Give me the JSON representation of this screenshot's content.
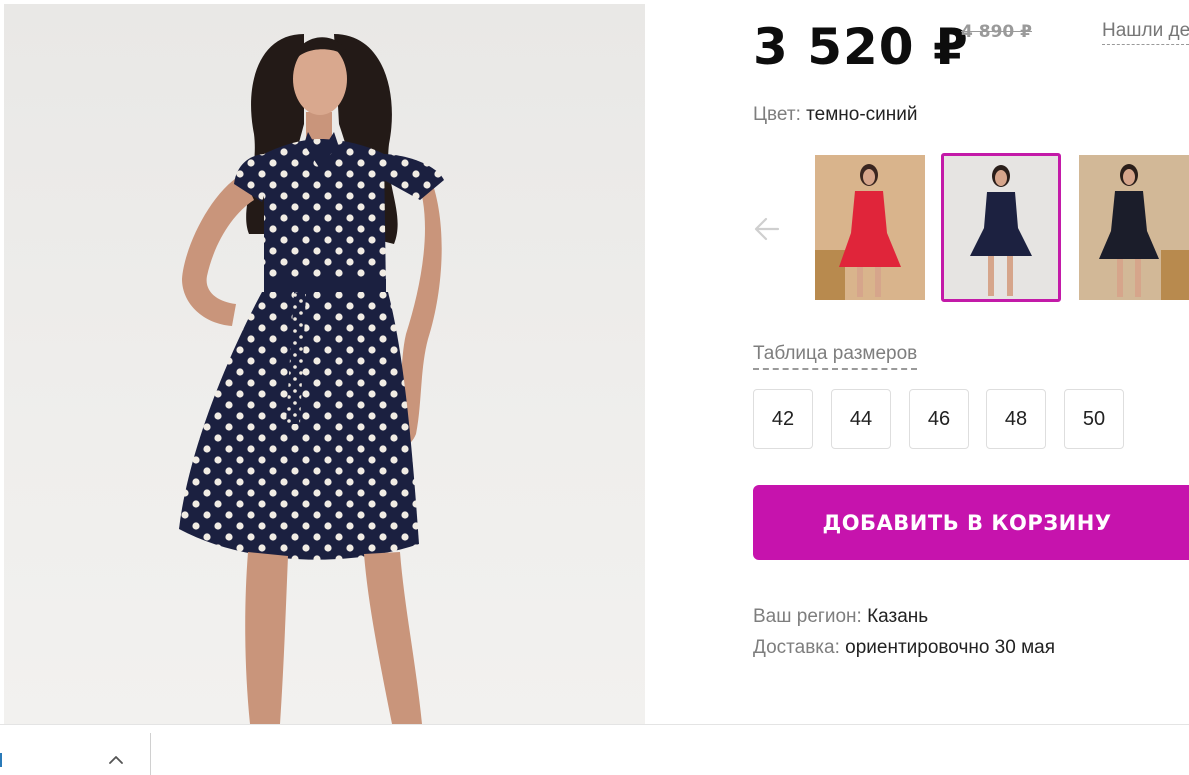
{
  "product": {
    "price_current": "3 520 ₽",
    "price_old": "4 890 ₽",
    "found_cheaper_link": "Нашли де"
  },
  "color": {
    "label": "Цвет:",
    "value": "темно-синий",
    "swatches": [
      {
        "name": "red-polka-dress",
        "selected": false,
        "dress_color": "#e0253a",
        "bg": "#d7b58e"
      },
      {
        "name": "navy-polka-dress",
        "selected": true,
        "dress_color": "#1c2140",
        "bg": "#e4e2e0"
      },
      {
        "name": "navy-polka-dress-alt",
        "selected": false,
        "dress_color": "#1b1d2a",
        "bg": "#cfb595"
      }
    ]
  },
  "sizes": {
    "table_link": "Таблица размеров",
    "options": [
      "42",
      "44",
      "46",
      "48",
      "50"
    ]
  },
  "cart": {
    "add_button": "ДОБАВИТЬ В КОРЗИНУ"
  },
  "delivery": {
    "region_label": "Ваш регион:",
    "region_value": "Казань",
    "delivery_label": "Доставка:",
    "delivery_value": "ориентировочно 30 мая"
  },
  "colors": {
    "accent": "#c613ad",
    "selected_border": "#c31aa8",
    "dress_navy": "#1a1f3a"
  },
  "icons": {
    "prev": "arrow-left-icon",
    "collapse": "chevron-up-icon"
  }
}
